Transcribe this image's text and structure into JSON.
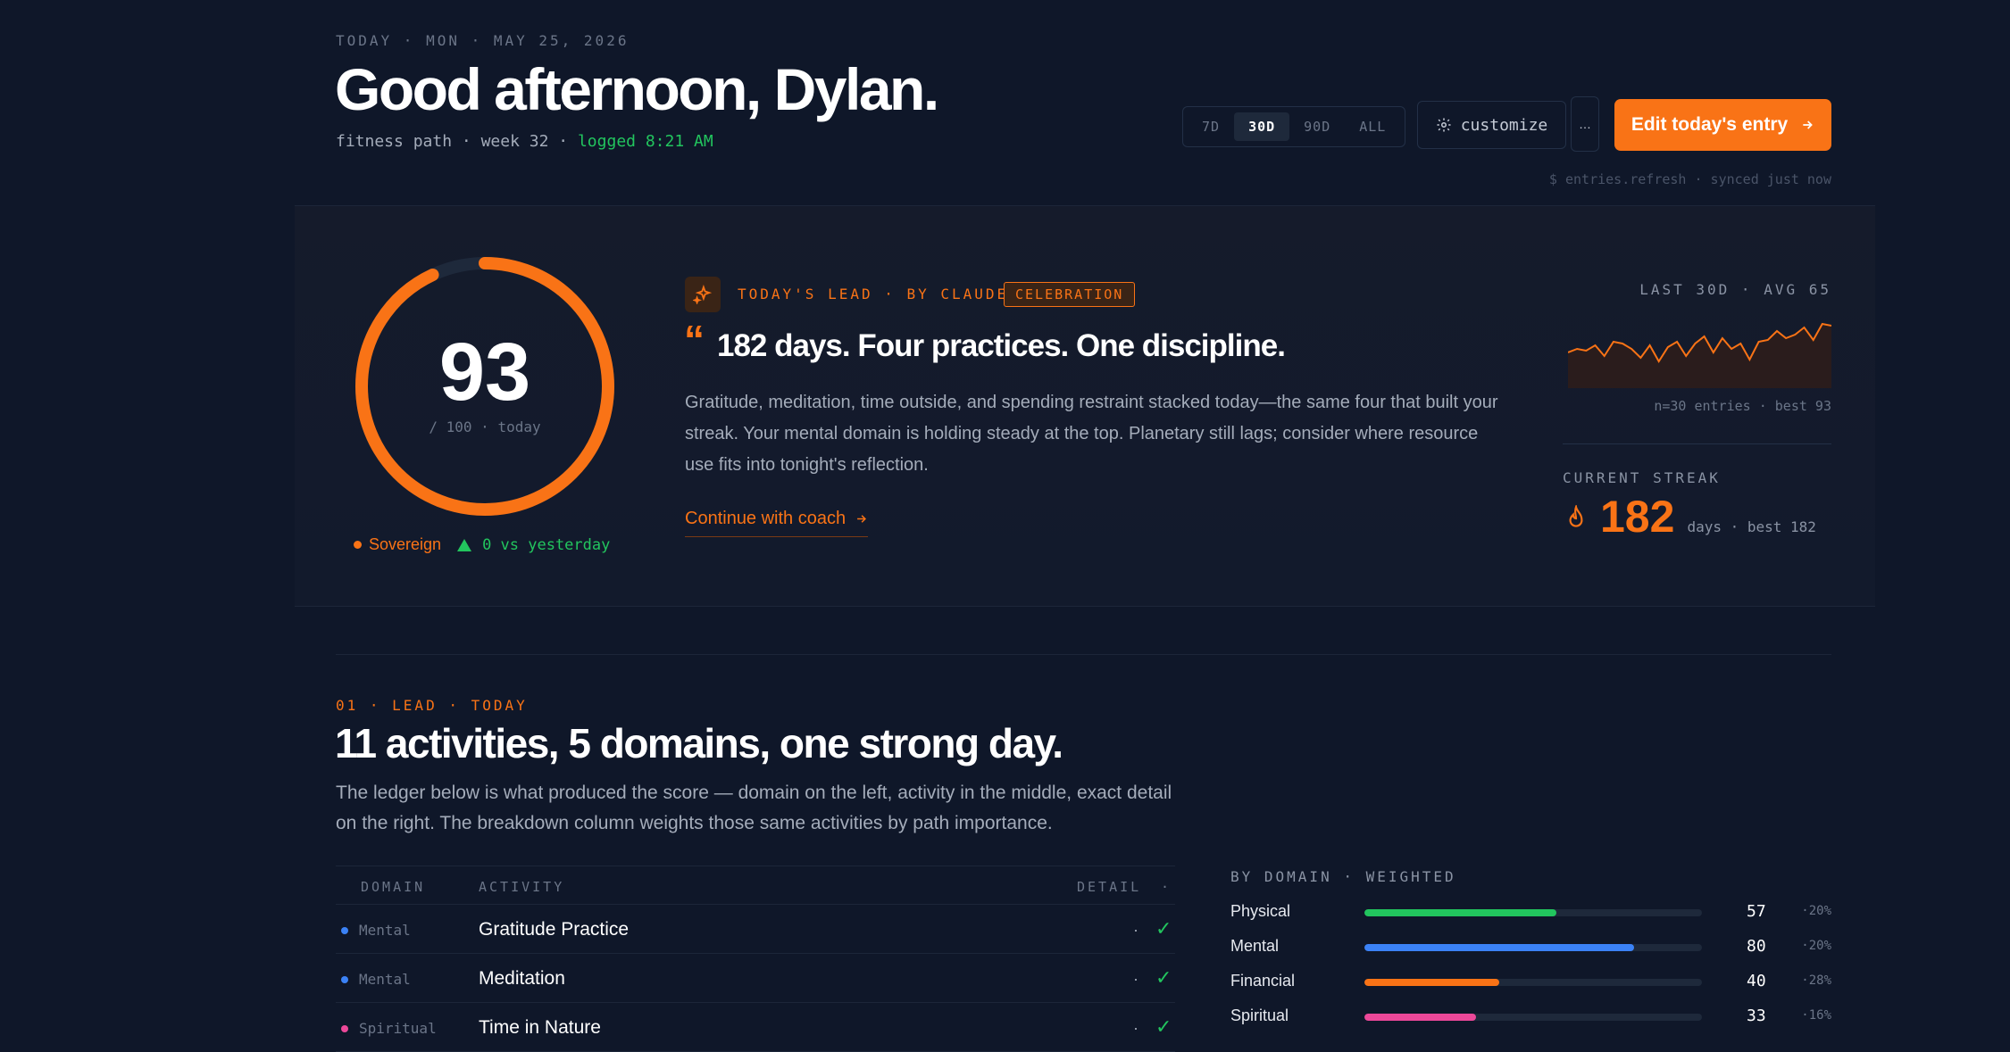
{
  "header": {
    "date_line": "TODAY · MON · MAY 25, 2026",
    "greeting": "Good afternoon, Dylan.",
    "path": "fitness path",
    "week": "week 32",
    "logged": "logged 8:21 AM",
    "sep": "·"
  },
  "toolbar": {
    "ranges": [
      "7D",
      "30D",
      "90D",
      "ALL"
    ],
    "active_range": "30D",
    "customize_label": "customize",
    "more_label": "…",
    "cta_label": "Edit today's entry",
    "sync_text": "$ entries.refresh · synced just now"
  },
  "score": {
    "value": "93",
    "value_num": 93,
    "max": 100,
    "sub": "/ 100 · today",
    "tier": "Sovereign",
    "delta": "0 vs yesterday"
  },
  "lead": {
    "kicker": "TODAY'S LEAD · BY CLAUDE",
    "badge": "CELEBRATION",
    "quote_mark": "“",
    "headline": "182 days. Four practices. One discipline.",
    "body": "Gratitude, meditation, time outside, and spending restraint stacked today—the same four that built your streak. Your mental domain is holding steady at the top. Planetary still lags; consider where resource use fits into tonight's reflection.",
    "cta": "Continue with coach"
  },
  "trend": {
    "label": "LAST 30D · AVG 65",
    "footer": "n=30 entries · best 93",
    "values": [
      60,
      62,
      61,
      64,
      58,
      66,
      65,
      62,
      57,
      64,
      55,
      63,
      66,
      58,
      65,
      69,
      60,
      68,
      62,
      65,
      56,
      66,
      67,
      72,
      68,
      70,
      74,
      67,
      76,
      75
    ],
    "accent": "#f97316"
  },
  "streak": {
    "label": "CURRENT STREAK",
    "value": "182",
    "sub": "days · best 182"
  },
  "section": {
    "kicker": "01 · LEAD · TODAY",
    "title": "11 activities, 5 domains, one strong day.",
    "body": "The ledger below is what produced the score — domain on the left, activity in the middle, exact detail on the right. The breakdown column weights those same activities by path importance."
  },
  "ledger": {
    "headers": {
      "domain": "DOMAIN",
      "activity": "ACTIVITY",
      "detail": "DETAIL",
      "status": "·"
    },
    "rows": [
      {
        "domain": "Mental",
        "activity": "Gratitude Practice",
        "detail": "·",
        "status": "✓",
        "color": "#3b82f6"
      },
      {
        "domain": "Mental",
        "activity": "Meditation",
        "detail": "·",
        "status": "✓",
        "color": "#3b82f6"
      },
      {
        "domain": "Spiritual",
        "activity": "Time in Nature",
        "detail": "·",
        "status": "✓",
        "color": "#ec4899"
      }
    ]
  },
  "breakdown": {
    "label": "BY DOMAIN · WEIGHTED",
    "rows": [
      {
        "name": "Physical",
        "value": "57",
        "pct": 57,
        "weight": "·20%",
        "color": "#22c55e"
      },
      {
        "name": "Mental",
        "value": "80",
        "pct": 80,
        "weight": "·20%",
        "color": "#3b82f6"
      },
      {
        "name": "Financial",
        "value": "40",
        "pct": 40,
        "weight": "·28%",
        "color": "#f97316"
      },
      {
        "name": "Spiritual",
        "value": "33",
        "pct": 33,
        "weight": "·16%",
        "color": "#ec4899"
      }
    ]
  },
  "colors": {
    "accent": "#f97316",
    "positive": "#22c55e",
    "background": "#0f1729"
  },
  "icons": {
    "lead": "sparkle-icon",
    "customize": "gear-icon",
    "cta": "arrow-right-icon",
    "streak": "flame-icon",
    "delta": "triangle-up-icon"
  }
}
